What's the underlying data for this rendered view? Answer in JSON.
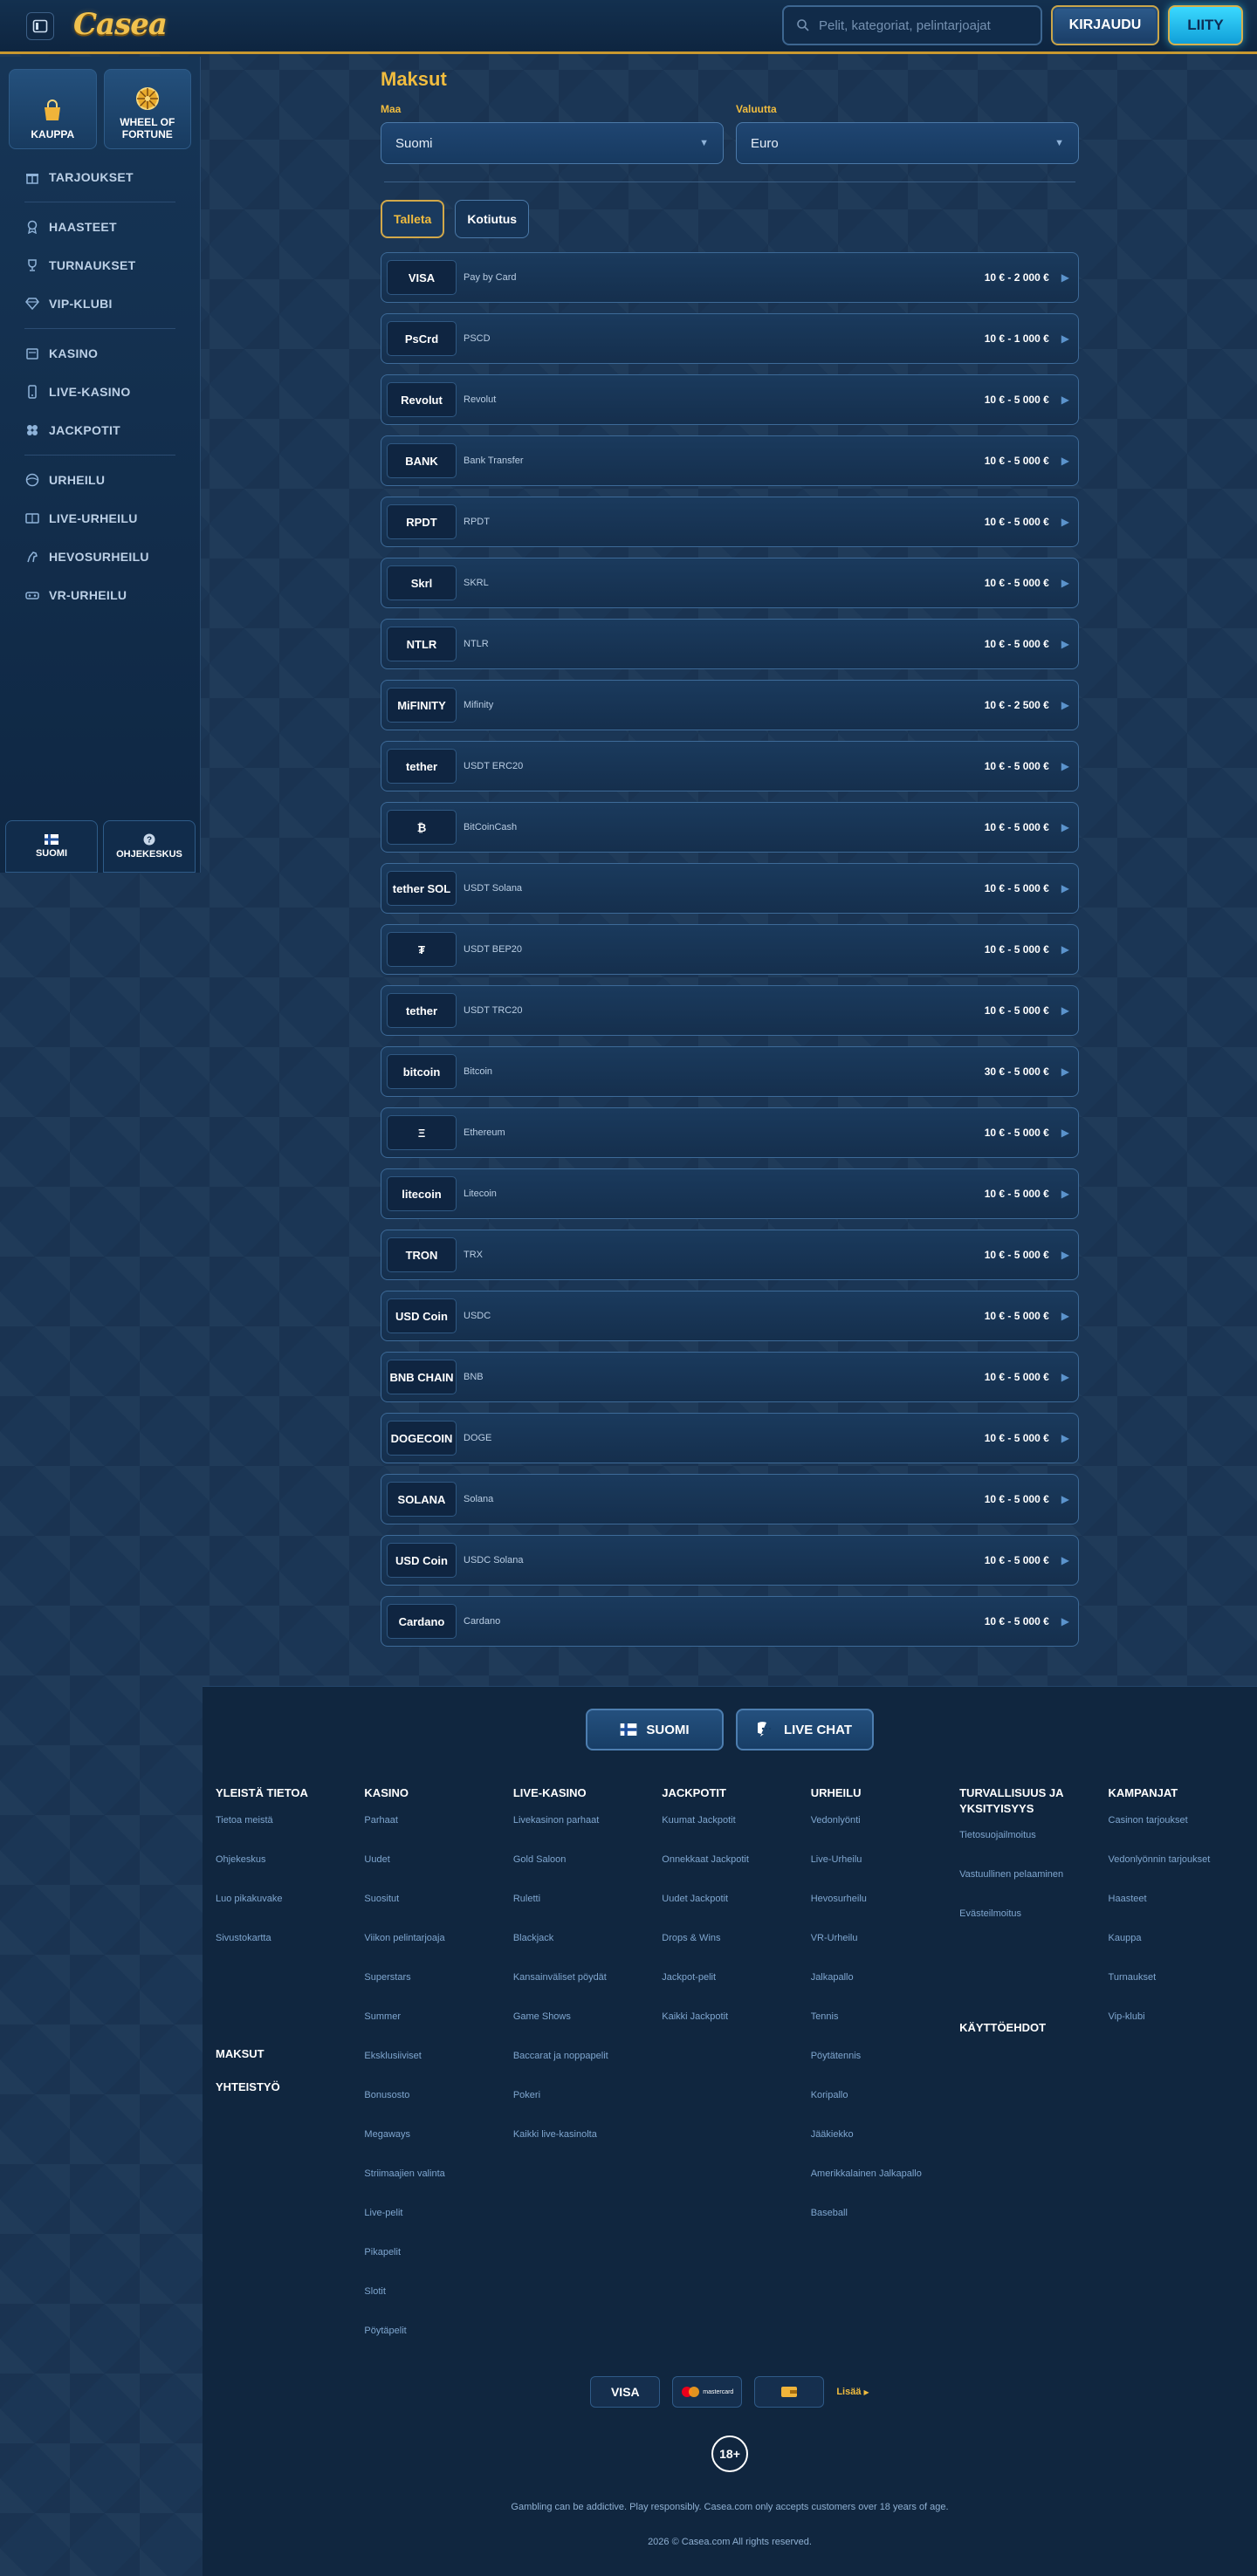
{
  "header": {
    "logo": "Casea",
    "search_placeholder": "Pelit, kategoriat, pelintarjoajat",
    "login_label": "KIRJAUDU",
    "join_label": "LIITY"
  },
  "sidebar": {
    "shop_label": "KAUPPA",
    "wheel_label": "WHEEL OF FORTUNE",
    "group1": [
      {
        "label": "TARJOUKSET"
      }
    ],
    "group2": [
      {
        "label": "HAASTEET"
      },
      {
        "label": "TURNAUKSET"
      },
      {
        "label": "VIP-KLUBI"
      }
    ],
    "group3": [
      {
        "label": "KASINO"
      },
      {
        "label": "LIVE-KASINO"
      },
      {
        "label": "JACKPOTIT"
      }
    ],
    "group4": [
      {
        "label": "URHEILU"
      },
      {
        "label": "LIVE-URHEILU"
      },
      {
        "label": "HEVOSURHEILU"
      },
      {
        "label": "VR-URHEILU"
      }
    ],
    "language_label": "SUOMI",
    "help_label": "OHJEKESKUS"
  },
  "main": {
    "title": "Maksut",
    "country_label": "Maa",
    "country_value": "Suomi",
    "currency_label": "Valuutta",
    "currency_value": "Euro",
    "tab_deposit": "Talleta",
    "tab_withdraw": "Kotiutus"
  },
  "methods": [
    {
      "logo": "VISA",
      "name": "Pay by Card",
      "range": "10 € - 2 000 €"
    },
    {
      "logo": "PsCrd",
      "name": "PSCD",
      "range": "10 € - 1 000 €"
    },
    {
      "logo": "Revolut",
      "name": "Revolut",
      "range": "10 € - 5 000 €"
    },
    {
      "logo": "BANK",
      "name": "Bank Transfer",
      "range": "10 € - 5 000 €"
    },
    {
      "logo": "RPDT",
      "name": "RPDT",
      "range": "10 € - 5 000 €"
    },
    {
      "logo": "Skrl",
      "name": "SKRL",
      "range": "10 € - 5 000 €"
    },
    {
      "logo": "NTLR",
      "name": "NTLR",
      "range": "10 € - 5 000 €"
    },
    {
      "logo": "MiFINITY",
      "name": "Mifinity",
      "range": "10 € - 2 500 €"
    },
    {
      "logo": "tether",
      "name": "USDT ERC20",
      "range": "10 € - 5 000 €"
    },
    {
      "logo": "₿",
      "name": "BitCoinCash",
      "range": "10 € - 5 000 €"
    },
    {
      "logo": "tether SOL",
      "name": "USDT Solana",
      "range": "10 € - 5 000 €"
    },
    {
      "logo": "₮",
      "name": "USDT BEP20",
      "range": "10 € - 5 000 €"
    },
    {
      "logo": "tether",
      "name": "USDT TRC20",
      "range": "10 € - 5 000 €"
    },
    {
      "logo": "bitcoin",
      "name": "Bitcoin",
      "range": "30 € - 5 000 €"
    },
    {
      "logo": "Ξ",
      "name": "Ethereum",
      "range": "10 € - 5 000 €"
    },
    {
      "logo": "litecoin",
      "name": "Litecoin",
      "range": "10 € - 5 000 €"
    },
    {
      "logo": "TRON",
      "name": "TRX",
      "range": "10 € - 5 000 €"
    },
    {
      "logo": "USD Coin",
      "name": "USDC",
      "range": "10 € - 5 000 €"
    },
    {
      "logo": "BNB CHAIN",
      "name": "BNB",
      "range": "10 € - 5 000 €"
    },
    {
      "logo": "DOGECOIN",
      "name": "DOGE",
      "range": "10 € - 5 000 €"
    },
    {
      "logo": "SOLANA",
      "name": "Solana",
      "range": "10 € - 5 000 €"
    },
    {
      "logo": "USD Coin",
      "name": "USDC Solana",
      "range": "10 € - 5 000 €"
    },
    {
      "logo": "Cardano",
      "name": "Cardano",
      "range": "10 € - 5 000 €"
    }
  ],
  "footer": {
    "lang_button": "SUOMI",
    "chat_button": "LIVE CHAT",
    "columns": [
      {
        "title": "YLEISTÄ TIETOA",
        "links": [
          "Tietoa meistä",
          "Ohjekeskus",
          "Luo pikakuvake",
          "Sivustokartta"
        ],
        "extra": [
          "MAKSUT",
          "YHTEISTYÖ"
        ]
      },
      {
        "title": "KASINO",
        "links": [
          "Parhaat",
          "Uudet",
          "Suositut",
          "Viikon pelintarjoaja",
          "Superstars",
          "Summer",
          "Eksklusiiviset",
          "Bonusosto",
          "Megaways",
          "Striimaajien valinta",
          "Live-pelit",
          "Pikapelit",
          "Slotit",
          "Pöytäpelit"
        ],
        "extra": []
      },
      {
        "title": "LIVE-KASINO",
        "links": [
          "Livekasinon parhaat",
          "Gold Saloon",
          "Ruletti",
          "Blackjack",
          "Kansainväliset pöydät",
          "Game Shows",
          "Baccarat ja noppapelit",
          "Pokeri",
          "Kaikki live-kasinolta"
        ],
        "extra": []
      },
      {
        "title": "JACKPOTIT",
        "links": [
          "Kuumat Jackpotit",
          "Onnekkaat Jackpotit",
          "Uudet Jackpotit",
          "Drops & Wins",
          "Jackpot-pelit",
          "Kaikki Jackpotit"
        ],
        "extra": []
      },
      {
        "title": "URHEILU",
        "links": [
          "Vedonlyönti",
          "Live-Urheilu",
          "Hevosurheilu",
          "VR-Urheilu",
          "Jalkapallo",
          "Tennis",
          "Pöytätennis",
          "Koripallo",
          "Jääkiekko",
          "Amerikkalainen Jalkapallo",
          "Baseball"
        ],
        "extra": []
      },
      {
        "title": "TURVALLISUUS JA YKSITYISYYS",
        "links": [
          "Tietosuojailmoitus",
          "Vastuullinen pelaaminen",
          "Evästeilmoitus"
        ],
        "extra": [
          "KÄYTTÖEHDOT"
        ]
      },
      {
        "title": "KAMPANJAT",
        "links": [
          "Casinon tarjoukset",
          "Vedonlyönnin tarjoukset",
          "Haasteet",
          "Kauppa",
          "Turnaukset",
          "Vip-klubi"
        ],
        "extra": []
      }
    ],
    "pay_visa": "VISA",
    "pay_mc": "mastercard",
    "more_label": "Lisää",
    "age_badge": "18+",
    "disclaimer": "Gambling can be addictive. Play responsibly. Casea.com only accepts customers over 18 years of age.",
    "copyright": "2026 © Casea.com All rights reserved."
  },
  "colors": {
    "accent": "#f0bc3f",
    "join": "#3ad9ff",
    "bg": "#1b3655"
  }
}
